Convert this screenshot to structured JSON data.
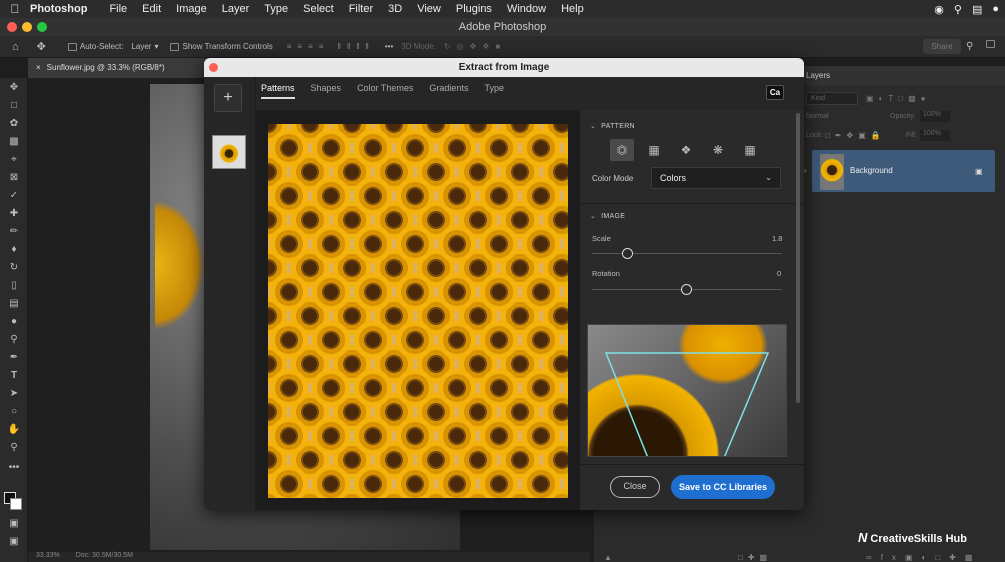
{
  "menubar": {
    "apple": "",
    "app_name": "Photoshop",
    "items": [
      "File",
      "Edit",
      "Image",
      "Layer",
      "Type",
      "Select",
      "Filter",
      "3D",
      "View",
      "Plugins",
      "Window",
      "Help"
    ]
  },
  "window": {
    "title": "Adobe Photoshop"
  },
  "options_bar": {
    "auto_select_label": "Auto-Select:",
    "auto_select_value": "Layer",
    "show_transform_label": "Show Transform Controls",
    "mode_3d_label": "3D Mode:",
    "share_label": "Share"
  },
  "document": {
    "tab_title": "Sunflower.jpg @ 33.3% (RGB/8*)",
    "zoom": "33.33%",
    "doc_info": "Doc: 30.5M/30.5M"
  },
  "layers_panel": {
    "title": "Layers",
    "kind_label": "Kind",
    "blend_mode": "Normal",
    "opacity_label": "Opacity:",
    "opacity_value": "100%",
    "lock_label": "Lock:",
    "fill_label": "Fill:",
    "fill_value": "100%",
    "layer_name": "Background"
  },
  "dialog": {
    "title": "Extract from Image",
    "add_button": "+",
    "tabs": [
      "Patterns",
      "Shapes",
      "Color Themes",
      "Gradients",
      "Type"
    ],
    "active_tab": "Patterns",
    "cc_badge": "Ca",
    "pattern_section": "PATTERN",
    "color_mode_label": "Color Mode",
    "color_mode_value": "Colors",
    "image_section": "IMAGE",
    "scale_label": "Scale",
    "scale_value": "1.8",
    "rotation_label": "Rotation",
    "rotation_value": "0",
    "close_button": "Close",
    "save_button": "Save to CC Libraries"
  },
  "watermark": {
    "text": "CreativeSkills Hub"
  },
  "colors": {
    "accent_blue": "#1f6fd1",
    "close_red": "#ff5f57",
    "layer_selected": "#3d5a7a"
  }
}
